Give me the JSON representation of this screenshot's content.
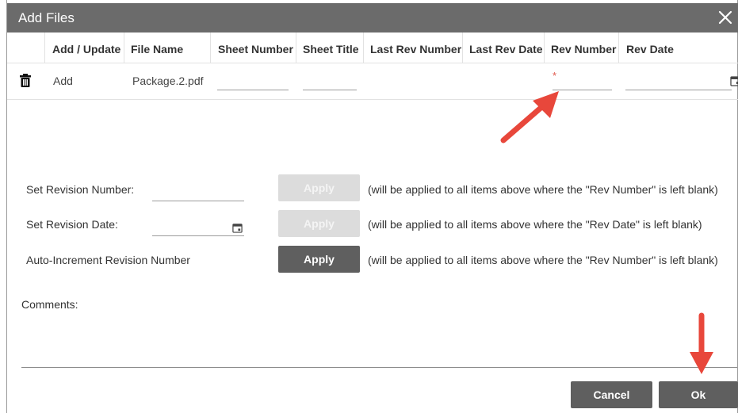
{
  "dialog": {
    "title": "Add Files"
  },
  "table": {
    "headers": [
      "Add / Update",
      "File Name",
      "Sheet Number",
      "Sheet Title",
      "Last Rev Number",
      "Last Rev Date",
      "Rev Number",
      "Rev Date"
    ],
    "row": {
      "action": "Add",
      "file_name": "Package.2.pdf",
      "sheet_number": "",
      "sheet_title": "",
      "last_rev_number": "",
      "last_rev_date": "",
      "rev_number": "",
      "rev_date": "",
      "required_marker": "*"
    }
  },
  "options": [
    {
      "label": "Set Revision Number:",
      "button": "Apply",
      "note": "(will be applied to all items above where the \"Rev Number\" is left blank)",
      "enabled": false
    },
    {
      "label": "Set Revision Date:",
      "button": "Apply",
      "note": "(will be applied to all items above where the \"Rev Date\" is left blank)",
      "enabled": false
    },
    {
      "label": "Auto-Increment Revision Number",
      "button": "Apply",
      "note": "(will be applied to all items above where the \"Rev Number\" is left blank)",
      "enabled": true
    }
  ],
  "comments": {
    "label": "Comments:",
    "value": ""
  },
  "footer": {
    "cancel_label": "Cancel",
    "ok_label": "Ok"
  },
  "colors": {
    "titlebar": "#6b6b6b",
    "button_dark": "#5f5f5f",
    "button_disabled": "#dcdcdc",
    "annotation_arrow": "#e8473b"
  },
  "icons": [
    "close-icon",
    "trash-icon",
    "calendar-icon"
  ]
}
